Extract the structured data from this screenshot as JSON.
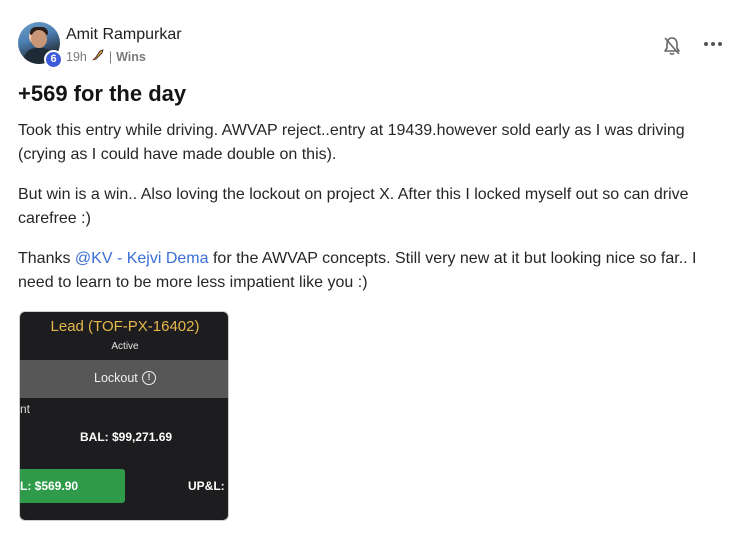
{
  "post": {
    "author": "Amit Rampurkar",
    "level_badge": "6",
    "time": "19h",
    "category_icon": "rocket-icon",
    "separator": "|",
    "category": "Wins",
    "title": "+569 for the day",
    "paragraphs": {
      "p1": "Took this entry while driving. AWVAP reject..entry at 19439.however sold early as I was driving (crying as I could have made double on this).",
      "p2": "But win is a win.. Also loving the lockout on project X. After this I locked myself out so can drive carefree :)",
      "p3_before": "Thanks ",
      "p3_mention": "@KV - Kejvi Dema",
      "p3_after": " for the AWVAP concepts. Still very new at it but looking nice so far.. I need to learn to be more less impatient like you :)"
    },
    "icons": {
      "bell": "bell-off-icon",
      "more": "more-dots-icon"
    },
    "attachment": {
      "lead": "Lead (TOF-PX-16402)",
      "status": "Active",
      "lockout": "Lockout",
      "info_icon": "info-icon",
      "info_glyph": "!",
      "cut_text": "nt",
      "balance": "BAL: $99,271.69",
      "pnl": "L: $569.90",
      "upnl": "UP&L: $"
    },
    "colors": {
      "accent_link": "#3a6fd8",
      "badge": "#3b5bdb",
      "lead_text": "#e6b84b",
      "pnl_green": "#2e9a4a"
    }
  }
}
